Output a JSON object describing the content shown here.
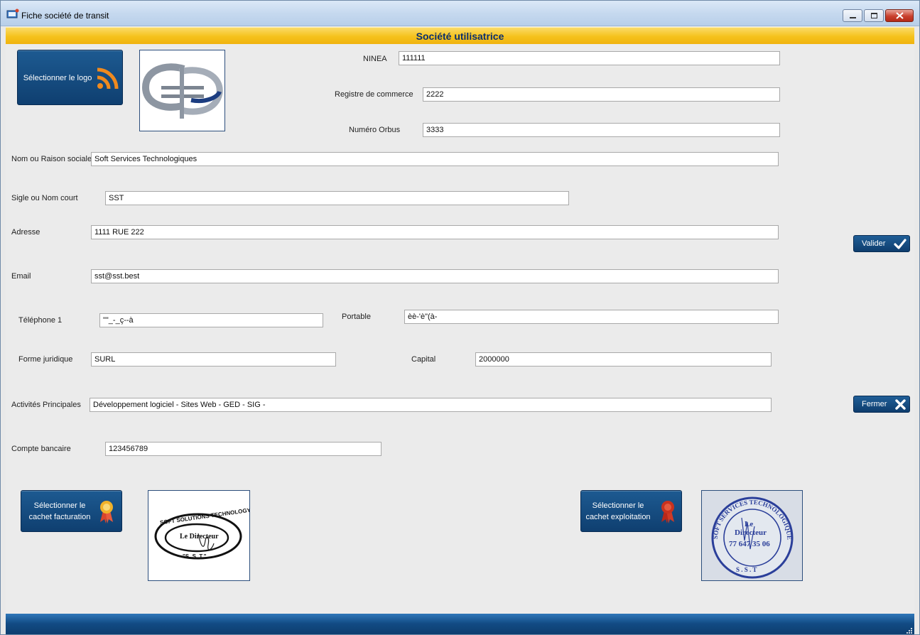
{
  "window": {
    "title": "Fiche société de transit"
  },
  "header": {
    "title": "Société utilisatrice"
  },
  "buttons": {
    "select_logo": "Sélectionner le logo",
    "select_billing_stamp_line1": "Sélectionner le",
    "select_billing_stamp_line2": "cachet facturation",
    "select_ops_stamp_line1": "Sélectionner le",
    "select_ops_stamp_line2": "cachet exploitation",
    "validate": "Valider",
    "close": "Fermer"
  },
  "fields": {
    "ninea": {
      "label": "NINEA",
      "value": "111111"
    },
    "registre": {
      "label": "Registre de commerce",
      "value": "2222"
    },
    "orbus": {
      "label": "Numéro Orbus",
      "value": "3333"
    },
    "raison_sociale": {
      "label": "Nom ou Raison sociale",
      "value": "Soft Services Technologiques"
    },
    "sigle": {
      "label": "Sigle ou Nom court",
      "value": "SST"
    },
    "adresse": {
      "label": "Adresse",
      "value": "1111 RUE 222"
    },
    "email": {
      "label": "Email",
      "value": "sst@sst.best"
    },
    "telephone1": {
      "label": "Téléphone 1",
      "value": "\"\"_-_ç--à"
    },
    "portable": {
      "label": "Portable",
      "value": "èè-'è\"(à-"
    },
    "forme_juridique": {
      "label": "Forme juridique",
      "value": "SURL"
    },
    "capital": {
      "label": "Capital",
      "value": "2000000"
    },
    "activites": {
      "label": "Activités Principales",
      "value": "Développement logiciel - Sites Web - GED - SIG -"
    },
    "compte_bancaire": {
      "label": "Compte bancaire",
      "value": "123456789"
    }
  },
  "stamps": {
    "billing": {
      "line1": "SOFT SOLUTIONS TECHNOLOGY",
      "line2": "Le Directeur",
      "line3": "\"S. S. T.\""
    },
    "ops": {
      "ring": "SOFT SERVICES TECHNOLOGIQUES",
      "line1": "Le",
      "line2": "Directeur",
      "phone": "77 647 35 06",
      "bottom": "S . S . T"
    }
  },
  "icons": [
    "app-icon",
    "rss-icon",
    "ribbon-icon",
    "checkmark-icon",
    "close-x-icon",
    "minimize-icon",
    "maximize-icon",
    "window-close-icon",
    "resize-grip-icon"
  ],
  "colors": {
    "accent_yellow": "#f5c21b",
    "button_blue": "#12487c",
    "title_text": "#0b2f6e"
  }
}
